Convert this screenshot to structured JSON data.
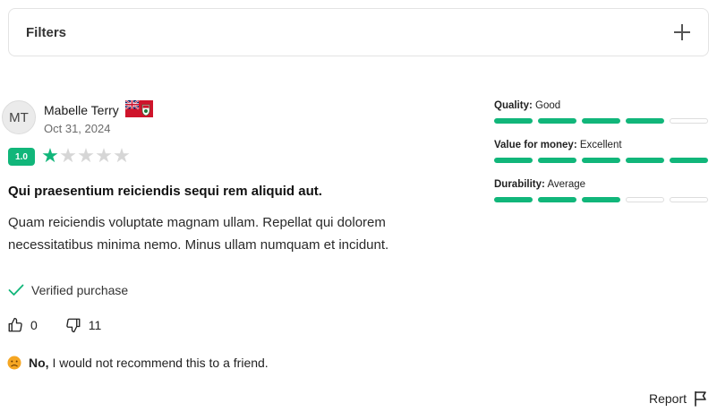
{
  "filters": {
    "label": "Filters",
    "icon": "plus-icon"
  },
  "review": {
    "reviewer": {
      "initials": "MT",
      "name": "Mabelle Terry",
      "date": "Oct 31, 2024",
      "flag_icon": "bermuda-flag-icon"
    },
    "rating": {
      "label": "1.0",
      "value": 1,
      "max": 5
    },
    "title": "Qui praesentium reiciendis sequi rem aliquid aut.",
    "body": "Quam reiciendis voluptate magnam ullam. Repellat qui dolorem necessitatibus minima nemo. Minus ullam numquam et incidunt.",
    "verified_label": "Verified purchase",
    "votes": {
      "up": "0",
      "down": "11"
    },
    "recommend": {
      "strong": "No,",
      "text": " I would not recommend this to a friend."
    },
    "report_label": "Report"
  },
  "attributes": [
    {
      "name": "Quality:",
      "value": "Good",
      "level": 4,
      "max": 5
    },
    {
      "name": "Value for money:",
      "value": "Excellent",
      "level": 5,
      "max": 5
    },
    {
      "name": "Durability:",
      "value": "Average",
      "level": 3,
      "max": 5
    }
  ],
  "colors": {
    "accent": "#11b67a",
    "empty": "#d6d6d6",
    "border": "#e3e3e3"
  }
}
